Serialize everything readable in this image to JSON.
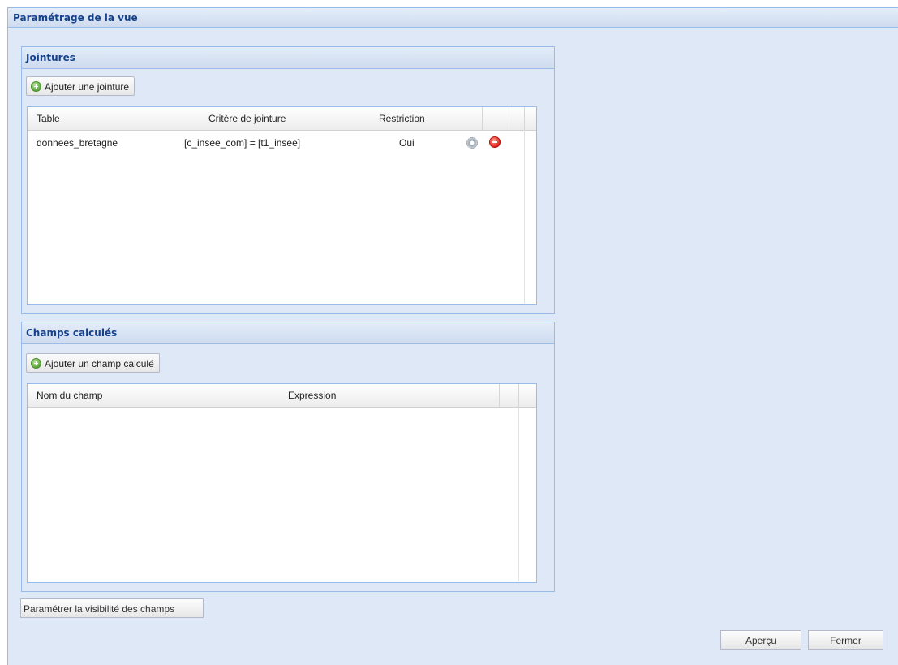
{
  "window": {
    "title": "Paramétrage de la vue"
  },
  "joins": {
    "title": "Jointures",
    "add_label": "Ajouter une jointure",
    "columns": [
      "Table",
      "Critère de jointure",
      "Restriction"
    ],
    "rows": [
      {
        "table": "donnees_bretagne",
        "criterion": "[c_insee_com] = [t1_insee]",
        "restriction": "Oui"
      }
    ]
  },
  "calculated": {
    "title": "Champs calculés",
    "add_label": "Ajouter un champ calculé",
    "columns": [
      "Nom du champ",
      "Expression"
    ]
  },
  "visibility_label": "Paramétrer la visibilité des champs",
  "footer": {
    "preview_label": "Aperçu",
    "close_label": "Fermer"
  },
  "icons": {
    "add": "plus-icon",
    "edit": "gear-icon",
    "delete": "delete-icon"
  }
}
